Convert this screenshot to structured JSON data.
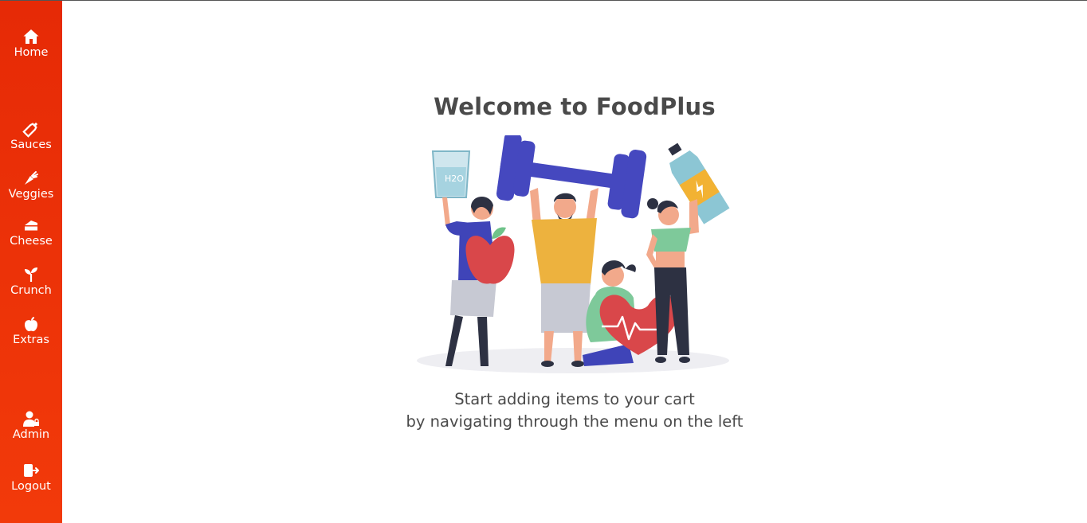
{
  "sidebar": {
    "items": [
      {
        "label": "Home",
        "icon": "home-icon"
      },
      {
        "label": "Sauces",
        "icon": "sauce-bottle-icon"
      },
      {
        "label": "Veggies",
        "icon": "carrot-icon"
      },
      {
        "label": "Cheese",
        "icon": "cheese-icon"
      },
      {
        "label": "Crunch",
        "icon": "seedling-icon"
      },
      {
        "label": "Extras",
        "icon": "apple-icon"
      },
      {
        "label": "Admin",
        "icon": "admin-user-icon"
      },
      {
        "label": "Logout",
        "icon": "logout-icon"
      }
    ],
    "color": "#ee3308"
  },
  "main": {
    "title": "Welcome to FoodPlus",
    "subtitle_line1": "Start adding items to your cart",
    "subtitle_line2": "by navigating through the menu on the left",
    "hero_image": "people-exercising-illustration",
    "label_text": "H2O"
  }
}
